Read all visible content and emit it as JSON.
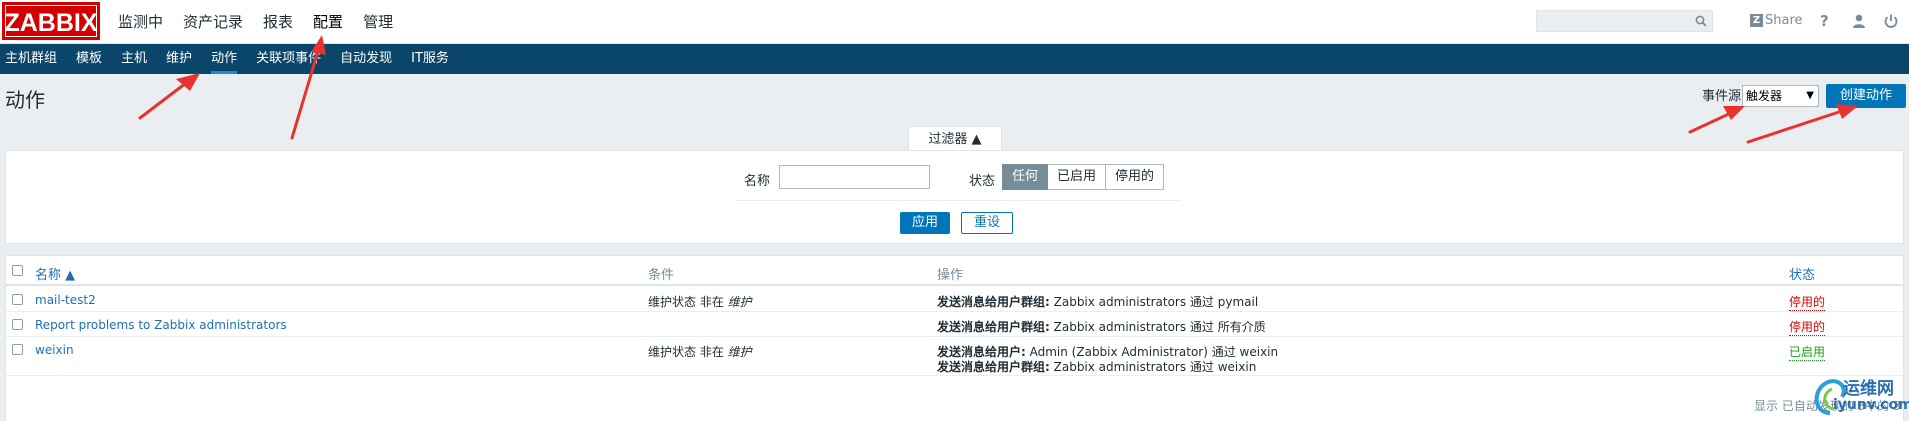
{
  "header": {
    "logo": "ZABBIX",
    "main_nav": [
      {
        "label": "监测中",
        "active": false
      },
      {
        "label": "资产记录",
        "active": false
      },
      {
        "label": "报表",
        "active": false
      },
      {
        "label": "配置",
        "active": true
      },
      {
        "label": "管理",
        "active": false
      }
    ],
    "search": {
      "value": "",
      "placeholder": ""
    },
    "share_label": "Share",
    "help_label": "?"
  },
  "sub_nav": [
    {
      "label": "主机群组",
      "active": false
    },
    {
      "label": "模板",
      "active": false
    },
    {
      "label": "主机",
      "active": false
    },
    {
      "label": "维护",
      "active": false
    },
    {
      "label": "动作",
      "active": true
    },
    {
      "label": "关联项事件",
      "active": false
    },
    {
      "label": "自动发现",
      "active": false
    },
    {
      "label": "IT服务",
      "active": false
    }
  ],
  "page": {
    "title": "动作",
    "event_source_label": "事件源",
    "event_source_value": "触发器",
    "create_button": "创建动作"
  },
  "filter": {
    "tab_label": "过滤器 ▲",
    "name_label": "名称",
    "name_value": "",
    "status_label": "状态",
    "status_options": [
      {
        "label": "任何",
        "selected": true
      },
      {
        "label": "已启用",
        "selected": false
      },
      {
        "label": "停用的",
        "selected": false
      }
    ],
    "apply_button": "应用",
    "reset_button": "重设"
  },
  "table": {
    "columns": {
      "name": "名称 ▲",
      "conditions": "条件",
      "operations": "操作",
      "status": "状态"
    },
    "rows": [
      {
        "name": "mail-test2",
        "condition_prefix": "维护状态 非在 ",
        "condition_value": "维护",
        "operations": [
          {
            "label": "发送消息给用户群组:",
            "text": " Zabbix administrators 通过 pymail"
          }
        ],
        "status": "停用的",
        "status_color": "#dc0000"
      },
      {
        "name": "Report problems to Zabbix administrators",
        "condition_prefix": "",
        "condition_value": "",
        "operations": [
          {
            "label": "发送消息给用户群组:",
            "text": " Zabbix administrators 通过 所有介质"
          }
        ],
        "status": "停用的",
        "status_color": "#dc0000"
      },
      {
        "name": "weixin",
        "condition_prefix": "维护状态 非在 ",
        "condition_value": "维护",
        "operations": [
          {
            "label": "发送消息给用户:",
            "text": " Admin (Zabbix Administrator) 通过 weixin"
          },
          {
            "label": "发送消息给用户群组:",
            "text": " Zabbix administrators 通过 weixin"
          }
        ],
        "status": "已启用",
        "status_color": "#1b9e1b"
      }
    ]
  },
  "footer": {
    "text": "显示 已自动发现的 3中的 3"
  },
  "watermark": {
    "line1": "运维网",
    "line2": "iyunv.com"
  },
  "colors": {
    "brand": "#d40000",
    "subnav_bg": "#0a466a",
    "primary_button": "#0275b8",
    "annotation": "#e8322e"
  }
}
